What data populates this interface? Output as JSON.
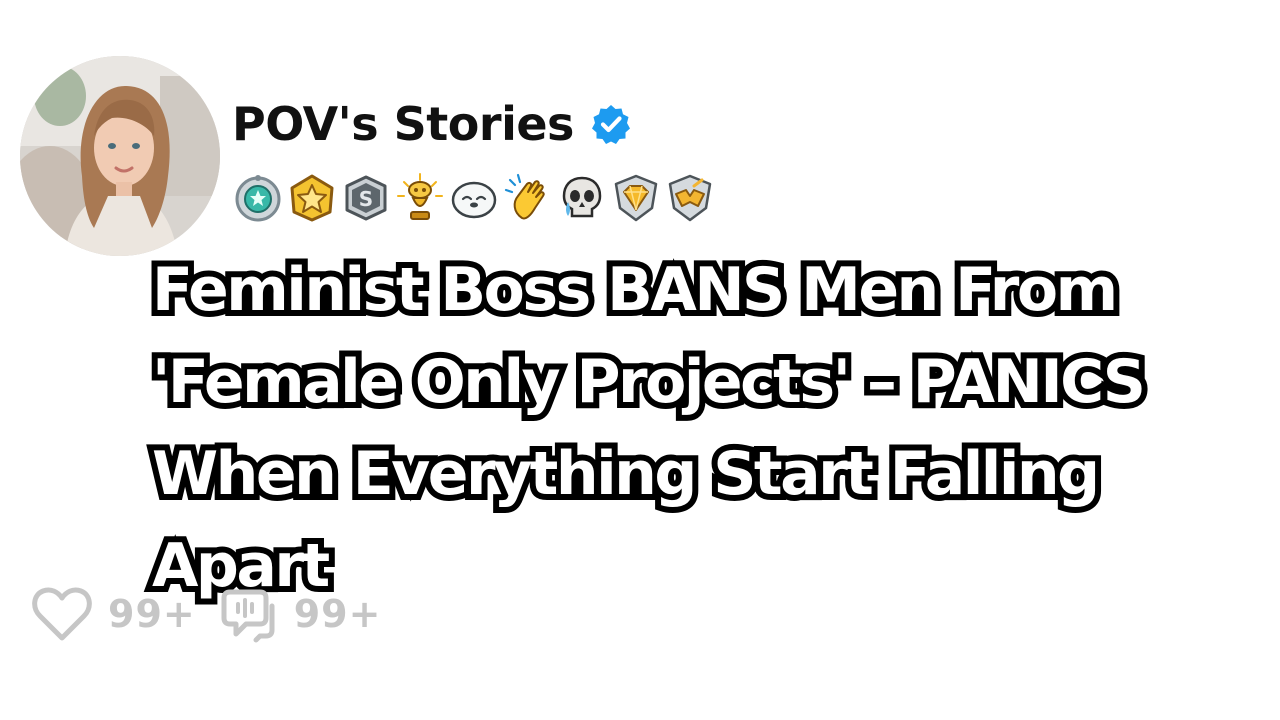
{
  "post": {
    "author": {
      "name": "POV's Stories",
      "verified": true,
      "verified_color": "#1d9bf0",
      "avatar_icon": "profile-photo-woman"
    },
    "badges": [
      "silver-helper-badge",
      "gold-star-badge",
      "silver-s-badge",
      "gold-trophy-mascot-badge",
      "seal-emoji-badge",
      "clapping-hands-badge",
      "crying-skull-badge",
      "gold-diamond-badge",
      "silver-wings-badge"
    ],
    "headline": "Feminist Boss BANS Men From\n'Female Only Projects' – PANICS\nWhen Everything Start Falling\nApart",
    "actions": {
      "likes": {
        "icon": "heart-icon",
        "count": "99+"
      },
      "comments": {
        "icon": "comment-icon",
        "count": "99+"
      }
    }
  }
}
